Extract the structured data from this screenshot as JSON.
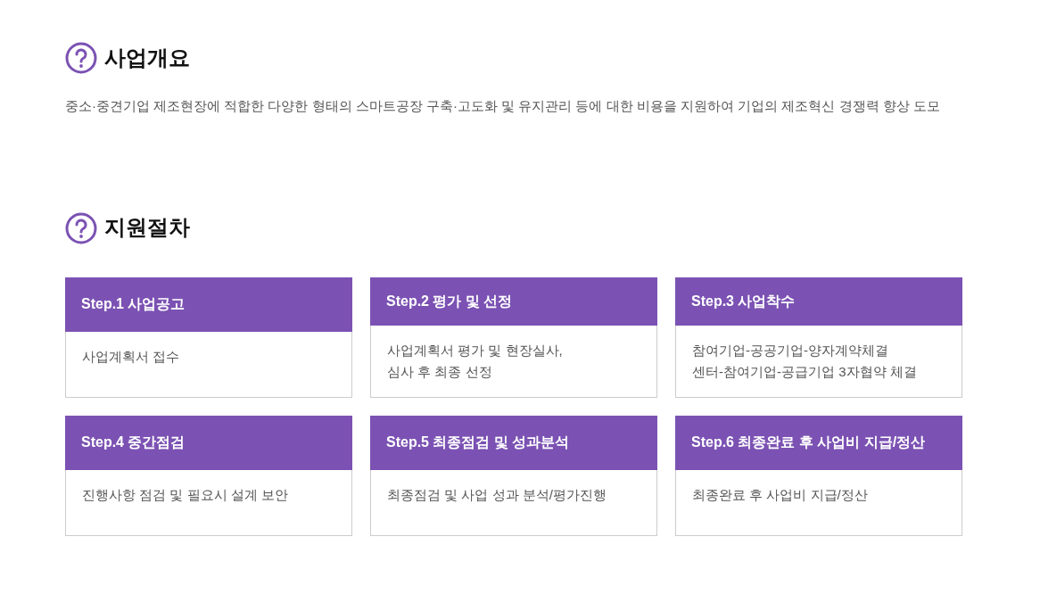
{
  "sections": [
    {
      "title": "사업개요",
      "text": "중소·중견기업 제조현장에 적합한 다양한 형태의 스마트공장 구축·고도화 및 유지관리 등에 대한 비용을 지원하여 기업의 제조혁신 경쟁력 향상 도모"
    },
    {
      "title": "지원절차",
      "steps": [
        {
          "title": "Step.1 사업공고",
          "lines": [
            "사업계획서 접수"
          ]
        },
        {
          "title": "Step.2 평가 및 선정",
          "lines": [
            "사업계획서 평가 및 현장실사,",
            "심사 후 최종 선정"
          ]
        },
        {
          "title": "Step.3 사업착수",
          "lines": [
            "참여기업-공공기업-양자계약체결",
            "센터-참여기업-공급기업 3자협약 체결"
          ]
        },
        {
          "title": "Step.4 중간점검",
          "lines": [
            "진행사항 점검 및 필요시 설계 보안"
          ]
        },
        {
          "title": "Step.5 최종점검 및 성과분석",
          "lines": [
            "최종점검 및 사업 성과 분석/평가진행"
          ]
        },
        {
          "title": "Step.6 최종완료 후 사업비 지급/정산",
          "lines": [
            "최종완료 후 사업비 지급/정산"
          ]
        }
      ]
    }
  ]
}
